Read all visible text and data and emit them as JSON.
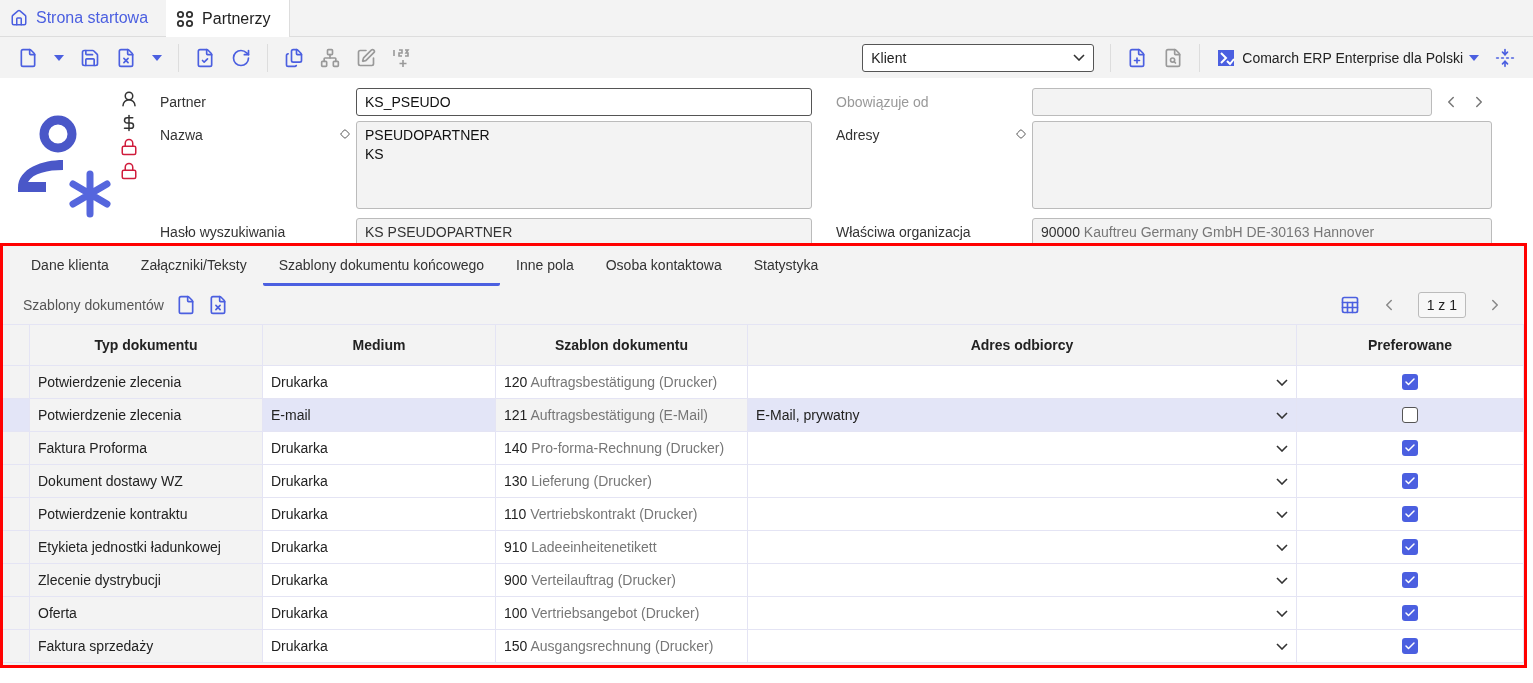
{
  "app_tabs": [
    {
      "label": "Strona startowa",
      "selected": false
    },
    {
      "label": "Partnerzy",
      "selected": true
    }
  ],
  "toolbar": {
    "view_select": {
      "value": "Klient"
    },
    "company": "Comarch ERP Enterprise dla Polski"
  },
  "form": {
    "left": [
      {
        "label": "Partner",
        "value": "KS_PSEUDO",
        "kind": "input",
        "marker": false
      },
      {
        "label": "Nazwa",
        "value": "PSEUDOPARTNER\nKS",
        "kind": "area",
        "marker": true
      },
      {
        "label": "Hasło wyszukiwania",
        "value": "KS PSEUDOPARTNER",
        "kind": "readonly",
        "marker": false
      }
    ],
    "right": [
      {
        "label": "Obowiązuje od",
        "kind": "date",
        "marker": false,
        "disabled": true
      },
      {
        "label": "Adresy",
        "kind": "area",
        "marker": true,
        "disabled": false
      },
      {
        "label": "Właściwa organizacja",
        "code": "90000",
        "value": "Kauftreu Germany GmbH DE-30163 Hannover",
        "kind": "readonly",
        "marker": false,
        "disabled": false
      }
    ]
  },
  "detail_tabs": [
    {
      "label": "Dane klienta",
      "selected": false
    },
    {
      "label": "Załączniki/Teksty",
      "selected": false
    },
    {
      "label": "Szablony dokumentu końcowego",
      "selected": true
    },
    {
      "label": "Inne pola",
      "selected": false
    },
    {
      "label": "Osoba kontaktowa",
      "selected": false
    },
    {
      "label": "Statystyka",
      "selected": false
    }
  ],
  "section_title": "Szablony dokumentów",
  "pager": "1 z 1",
  "table": {
    "columns": [
      "Typ dokumentu",
      "Medium",
      "Szablon dokumentu",
      "Adres odbiorcy",
      "Preferowane"
    ],
    "rows": [
      {
        "type": "Potwierdzenie zlecenia",
        "medium": "Drukarka",
        "code": "120",
        "template": "Auftragsbestätigung (Drucker)",
        "address": "",
        "preferred": true,
        "selected": false
      },
      {
        "type": "Potwierdzenie zlecenia",
        "medium": "E-mail",
        "code": "121",
        "template": "Auftragsbestätigung (E-Mail)",
        "address": "E-Mail, prywatny",
        "preferred": false,
        "selected": true
      },
      {
        "type": "Faktura Proforma",
        "medium": "Drukarka",
        "code": "140",
        "template": "Pro-forma-Rechnung (Drucker)",
        "address": "",
        "preferred": true,
        "selected": false
      },
      {
        "type": "Dokument dostawy WZ",
        "medium": "Drukarka",
        "code": "130",
        "template": "Lieferung (Drucker)",
        "address": "",
        "preferred": true,
        "selected": false
      },
      {
        "type": "Potwierdzenie kontraktu",
        "medium": "Drukarka",
        "code": "110",
        "template": "Vertriebskontrakt (Drucker)",
        "address": "",
        "preferred": true,
        "selected": false
      },
      {
        "type": "Etykieta jednostki ładunkowej",
        "medium": "Drukarka",
        "code": "910",
        "template": "Ladeeinheitenetikett",
        "address": "",
        "preferred": true,
        "selected": false
      },
      {
        "type": "Zlecenie dystrybucji",
        "medium": "Drukarka",
        "code": "900",
        "template": "Verteilauftrag (Drucker)",
        "address": "",
        "preferred": true,
        "selected": false
      },
      {
        "type": "Oferta",
        "medium": "Drukarka",
        "code": "100",
        "template": "Vertriebsangebot (Drucker)",
        "address": "",
        "preferred": true,
        "selected": false
      },
      {
        "type": "Faktura sprzedaży",
        "medium": "Drukarka",
        "code": "150",
        "template": "Ausgangsrechnung (Drucker)",
        "address": "",
        "preferred": true,
        "selected": false
      }
    ]
  }
}
